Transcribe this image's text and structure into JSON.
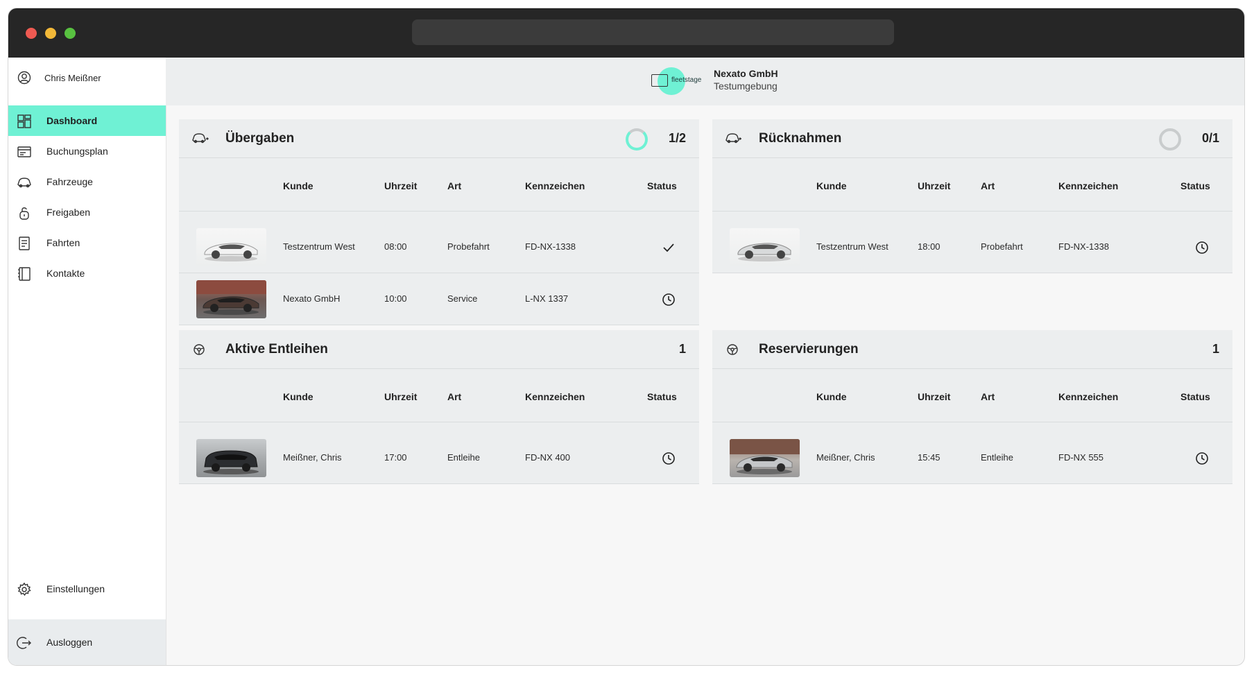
{
  "window": {
    "colors": {
      "accent": "#6ff1d4",
      "titlebar": "#262626",
      "panel": "#eceeef"
    }
  },
  "user": {
    "name": "Chris Meißner",
    "icon": "user-circle-icon"
  },
  "sidebar": {
    "items": [
      {
        "label": "Dashboard",
        "icon": "dashboard-icon",
        "active": true
      },
      {
        "label": "Buchungsplan",
        "icon": "calendar-list-icon"
      },
      {
        "label": "Fahrzeuge",
        "icon": "car-icon"
      },
      {
        "label": "Freigaben",
        "icon": "lock-icon"
      },
      {
        "label": "Fahrten",
        "icon": "document-icon"
      },
      {
        "label": "Kontakte",
        "icon": "contacts-icon"
      }
    ],
    "settings": {
      "label": "Einstellungen",
      "icon": "gear-icon"
    },
    "logout": {
      "label": "Ausloggen",
      "icon": "logout-icon"
    }
  },
  "header": {
    "logo_text": "fleetstage",
    "company": "Nexato GmbH",
    "environment": "Testumgebung"
  },
  "columns": {
    "kunde": "Kunde",
    "uhrzeit": "Uhrzeit",
    "art": "Art",
    "kennzeichen": "Kennzeichen",
    "status": "Status"
  },
  "panels": {
    "uebergaben": {
      "title": "Übergaben",
      "count": "1/2",
      "rows": [
        {
          "kunde": "Testzentrum West",
          "uhrzeit": "08:00",
          "art": "Probefahrt",
          "kennzeichen": "FD-NX-1338",
          "status": "check-icon"
        },
        {
          "kunde": "Nexato GmbH",
          "uhrzeit": "10:00",
          "art": "Service",
          "kennzeichen": "L-NX 1337",
          "status": "clock-icon"
        }
      ]
    },
    "ruecknahmen": {
      "title": "Rücknahmen",
      "count": "0/1",
      "rows": [
        {
          "kunde": "Testzentrum West",
          "uhrzeit": "18:00",
          "art": "Probefahrt",
          "kennzeichen": "FD-NX-1338",
          "status": "clock-icon"
        }
      ]
    },
    "aktive": {
      "title": "Aktive Entleihen",
      "count": "1",
      "rows": [
        {
          "kunde": "Meißner, Chris",
          "uhrzeit": "17:00",
          "art": "Entleihe",
          "kennzeichen": "FD-NX 400",
          "status": "clock-icon"
        }
      ]
    },
    "reservierungen": {
      "title": "Reservierungen",
      "count": "1",
      "rows": [
        {
          "kunde": "Meißner, Chris",
          "uhrzeit": "15:45",
          "art": "Entleihe",
          "kennzeichen": "FD-NX 555",
          "status": "clock-icon"
        }
      ]
    }
  }
}
